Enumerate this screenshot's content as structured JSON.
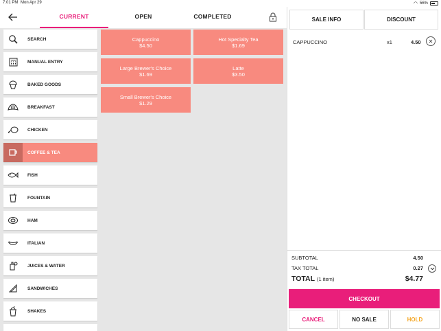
{
  "status_bar": {
    "time": "7:01 PM",
    "date": "Mon Apr 29",
    "battery": "56%"
  },
  "tabs": [
    {
      "label": "CURRENT",
      "active": true
    },
    {
      "label": "OPEN",
      "active": false
    },
    {
      "label": "COMPLETED",
      "active": false
    }
  ],
  "categories": [
    {
      "label": "SEARCH",
      "icon": "search-icon"
    },
    {
      "label": "MANUAL ENTRY",
      "icon": "calculator-icon"
    },
    {
      "label": "BAKED GOODS",
      "icon": "cupcake-icon"
    },
    {
      "label": "BREAKFAST",
      "icon": "croissant-icon"
    },
    {
      "label": "CHICKEN",
      "icon": "drumstick-icon"
    },
    {
      "label": "COFFEE & TEA",
      "icon": "mug-icon",
      "active": true
    },
    {
      "label": "FISH",
      "icon": "fish-icon"
    },
    {
      "label": "FOUNTAIN",
      "icon": "soda-icon"
    },
    {
      "label": "HAM",
      "icon": "ham-icon"
    },
    {
      "label": "ITALIAN",
      "icon": "pasta-icon"
    },
    {
      "label": "JUICES & WATER",
      "icon": "juice-icon"
    },
    {
      "label": "SANDWICHES",
      "icon": "sandwich-icon"
    },
    {
      "label": "SHAKES",
      "icon": "shake-icon"
    }
  ],
  "products": [
    {
      "name": "Cappuccino",
      "price": "$4.50"
    },
    {
      "name": "Hot Specialty Tea",
      "price": "$1.69"
    },
    {
      "name": "Large Brewer's Choice",
      "price": "$1.69"
    },
    {
      "name": "Latte",
      "price": "$3.50"
    },
    {
      "name": "Small Brewer's Choice",
      "price": "$1.29"
    }
  ],
  "right_tabs": {
    "sale_info": "SALE INFO",
    "discount": "DISCOUNT"
  },
  "cart": [
    {
      "name": "CAPPUCCINO",
      "qty": "x1",
      "price": "4.50"
    }
  ],
  "totals": {
    "subtotal_label": "SUBTOTAL",
    "subtotal": "4.50",
    "tax_label": "TAX TOTAL",
    "tax": "0.27",
    "total_label": "TOTAL",
    "total_items": "(1 item)",
    "total": "$4.77"
  },
  "actions": {
    "checkout": "CHECKOUT",
    "cancel": "CANCEL",
    "no_sale": "NO SALE",
    "hold": "HOLD"
  },
  "colors": {
    "accent": "#e91e7a",
    "tile": "#f88a7f",
    "tile_dark": "#c86a60",
    "hold": "#f5a623"
  }
}
